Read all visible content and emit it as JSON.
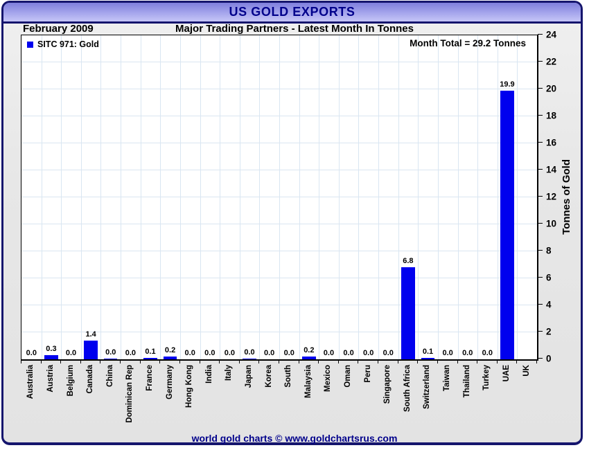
{
  "title_bar": {
    "title": "US GOLD EXPORTS"
  },
  "header": {
    "date": "February 2009",
    "subtitle": "Major Trading Partners - Latest Month In Tonnes"
  },
  "legend": {
    "label": "SITC 971: Gold"
  },
  "annotations": {
    "month_total": "Month Total = 29.2 Tonnes"
  },
  "footer": {
    "credit": "world gold charts © www.goldchartsrus.com"
  },
  "colors": {
    "bar": "#0000ee",
    "navy_text": "#00008b",
    "frame_border": "#15156d",
    "titlebar_gradient_top": "#7f7fdc",
    "titlebar_gradient_bottom": "#c6c6f7",
    "gridline": "#d9e6f2",
    "plot_background": "#ffffff",
    "body_background": "#e7e7e7"
  },
  "chart_data": {
    "type": "bar",
    "title": "US GOLD EXPORTS",
    "subtitle": "Major Trading Partners - Latest Month In Tonnes",
    "period": "February 2009",
    "month_total_tonnes": 29.2,
    "ylabel": "Tonnes of Gold",
    "ylim": [
      0,
      24
    ],
    "ytick_step": 2,
    "grid": true,
    "legend_position": "top-left",
    "legend_entries": [
      "SITC 971: Gold"
    ],
    "bar_color": "#0000ee",
    "categories": [
      "Australia",
      "Austria",
      "Belgium",
      "Canada",
      "China",
      "Dominican Rep",
      "France",
      "Germany",
      "Hong Kong",
      "India",
      "Italy",
      "Japan",
      "Korea",
      "South",
      "Malaysia",
      "Mexico",
      "Oman",
      "Peru",
      "Singapore",
      "South Africa",
      "Switzerland",
      "Taiwan",
      "Thailand",
      "Turkey",
      "UAE",
      "UK"
    ],
    "values": [
      0.0,
      0.3,
      0.0,
      1.4,
      0.0,
      0.0,
      0.1,
      0.2,
      0.0,
      0.0,
      0.0,
      0.0,
      0.0,
      0.0,
      0.2,
      0.0,
      0.0,
      0.0,
      0.0,
      6.8,
      0.1,
      0.0,
      0.0,
      0.0,
      19.9,
      null
    ],
    "value_labels": [
      "0.0",
      "0.3",
      "0.0",
      "1.4",
      "0.0",
      "0.0",
      "0.1",
      "0.2",
      "0.0",
      "0.0",
      "0.0",
      "0.0",
      "0.0",
      "0.0",
      "0.2",
      "0.0",
      "0.0",
      "0.0",
      "0.0",
      "6.8",
      "0.1",
      "0.0",
      "0.0",
      "0.0",
      "19.9",
      ""
    ],
    "bar_draw_values": [
      0,
      0.3,
      0,
      1.4,
      0.05,
      0,
      0.1,
      0.2,
      0,
      0,
      0,
      0.05,
      0,
      0,
      0.2,
      0,
      0,
      0,
      0,
      6.8,
      0.1,
      0,
      0,
      0,
      19.9,
      0
    ]
  }
}
